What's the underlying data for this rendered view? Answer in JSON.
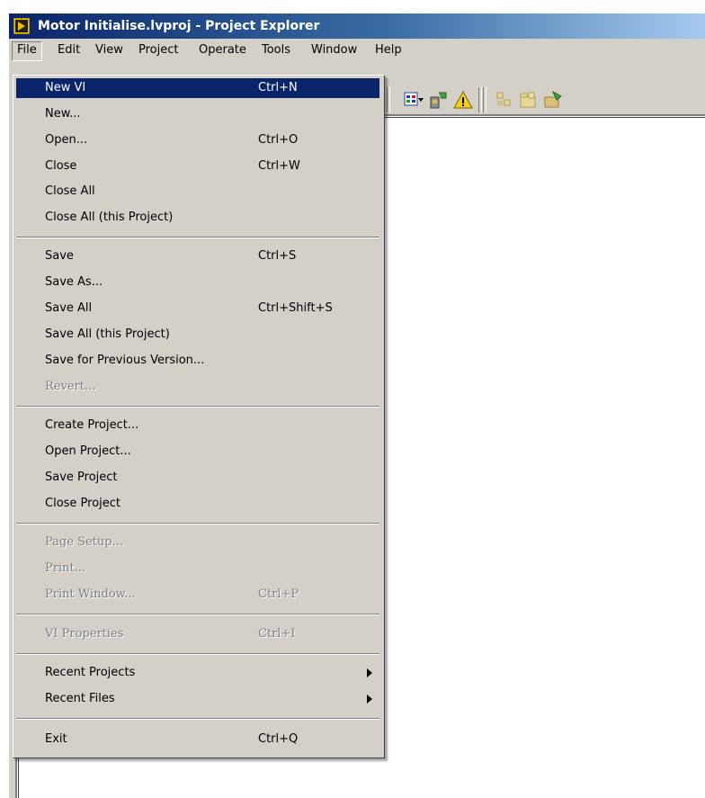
{
  "window": {
    "title": "Motor Initialise.lvproj - Project Explorer"
  },
  "menubar": {
    "items": [
      "File",
      "Edit",
      "View",
      "Project",
      "Operate",
      "Tools",
      "Window",
      "Help"
    ],
    "open_item": "File"
  },
  "file_menu": {
    "items": [
      {
        "label": "New VI",
        "shortcut": "Ctrl+N",
        "highlighted": true,
        "enabled": true
      },
      {
        "label": "New...",
        "shortcut": "",
        "enabled": true
      },
      {
        "label": "Open...",
        "shortcut": "Ctrl+O",
        "enabled": true
      },
      {
        "label": "Close",
        "shortcut": "Ctrl+W",
        "enabled": true
      },
      {
        "label": "Close All",
        "shortcut": "",
        "enabled": true
      },
      {
        "label": "Close All (this Project)",
        "shortcut": "",
        "enabled": true
      },
      {
        "label": "Save",
        "shortcut": "Ctrl+S",
        "enabled": true
      },
      {
        "label": "Save As...",
        "shortcut": "",
        "enabled": true
      },
      {
        "label": "Save All",
        "shortcut": "Ctrl+Shift+S",
        "enabled": true
      },
      {
        "label": "Save All (this Project)",
        "shortcut": "",
        "enabled": true
      },
      {
        "label": "Save for Previous Version...",
        "shortcut": "",
        "enabled": true
      },
      {
        "label": "Revert...",
        "shortcut": "",
        "enabled": false
      },
      {
        "label": "Create Project...",
        "shortcut": "",
        "enabled": true
      },
      {
        "label": "Open Project...",
        "shortcut": "",
        "enabled": true
      },
      {
        "label": "Save Project",
        "shortcut": "",
        "enabled": true
      },
      {
        "label": "Close Project",
        "shortcut": "",
        "enabled": true
      },
      {
        "label": "Page Setup...",
        "shortcut": "",
        "enabled": false
      },
      {
        "label": "Print...",
        "shortcut": "",
        "enabled": false
      },
      {
        "label": "Print Window...",
        "shortcut": "Ctrl+P",
        "enabled": false
      },
      {
        "label": "VI Properties",
        "shortcut": "Ctrl+I",
        "enabled": false
      },
      {
        "label": "Recent Projects",
        "shortcut": "",
        "enabled": true,
        "submenu": true
      },
      {
        "label": "Recent Files",
        "shortcut": "",
        "enabled": true,
        "submenu": true
      },
      {
        "label": "Exit",
        "shortcut": "Ctrl+Q",
        "enabled": true
      }
    ]
  },
  "toolbar": {
    "icons": [
      "view-as-dropdown-icon",
      "build-settings-icon",
      "warning-icon",
      "add-item-icon",
      "add-folder-icon",
      "deploy-icon"
    ]
  },
  "colors": {
    "highlight": "#0a246a",
    "face": "#d4d0c8",
    "disabled_text": "#808080"
  }
}
